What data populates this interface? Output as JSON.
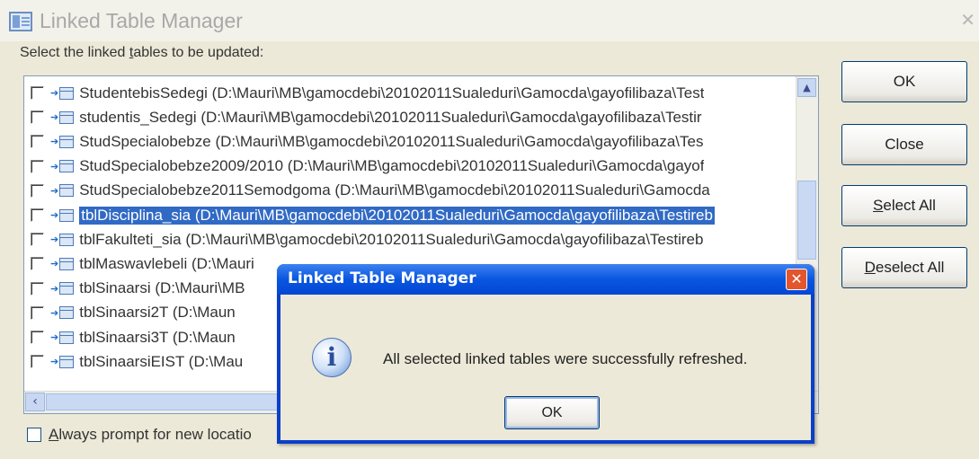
{
  "window": {
    "title": "Linked Table Manager",
    "instruction_prefix": "Select the linked ",
    "instruction_underlined": "t",
    "instruction_suffix": "ables to be updated:"
  },
  "tables": [
    {
      "label": "StudentebisSedegi   (D:\\Mauri\\MB\\gamocdebi\\20102011Sualeduri\\Gamocda\\gayofilibaza\\Test",
      "selected": false
    },
    {
      "label": "studentis_Sedegi   (D:\\Mauri\\MB\\gamocdebi\\20102011Sualeduri\\Gamocda\\gayofilibaza\\Testir",
      "selected": false
    },
    {
      "label": "StudSpecialobebze   (D:\\Mauri\\MB\\gamocdebi\\20102011Sualeduri\\Gamocda\\gayofilibaza\\Tes",
      "selected": false
    },
    {
      "label": "StudSpecialobebze2009/2010   (D:\\Mauri\\MB\\gamocdebi\\20102011Sualeduri\\Gamocda\\gayof",
      "selected": false
    },
    {
      "label": "StudSpecialobebze2011Semodgoma   (D:\\Mauri\\MB\\gamocdebi\\20102011Sualeduri\\Gamocda",
      "selected": false
    },
    {
      "label": "tblDisciplina_sia   (D:\\Mauri\\MB\\gamocdebi\\20102011Sualeduri\\Gamocda\\gayofilibaza\\Testireb",
      "selected": true
    },
    {
      "label": "tblFakulteti_sia   (D:\\Mauri\\MB\\gamocdebi\\20102011Sualeduri\\Gamocda\\gayofilibaza\\Testireb",
      "selected": false
    },
    {
      "label": "tblMaswavlebeli   (D:\\Mauri",
      "selected": false
    },
    {
      "label": "tblSinaarsi   (D:\\Mauri\\MB",
      "selected": false
    },
    {
      "label": "tblSinaarsi2T   (D:\\Maun",
      "selected": false
    },
    {
      "label": "tblSinaarsi3T   (D:\\Maun",
      "selected": false
    },
    {
      "label": "tblSinaarsiEIST   (D:\\Mau",
      "selected": false
    }
  ],
  "buttons": {
    "ok": "OK",
    "close": "Close",
    "select_all_u": "S",
    "select_all_rest": "elect All",
    "deselect_all_u": "D",
    "deselect_all_rest": "eselect All"
  },
  "prompt": {
    "u": "A",
    "rest": "lways prompt for new locatio"
  },
  "dialog": {
    "title": "Linked Table Manager",
    "message": "All selected linked tables were successfully refreshed.",
    "ok": "OK"
  },
  "icons": {
    "app": "linked-table-icon",
    "info": "info-icon",
    "close": "close-icon"
  },
  "colors": {
    "selection": "#316ac5",
    "dialog_title": "#0a56e0",
    "close_button": "#e3552c"
  }
}
